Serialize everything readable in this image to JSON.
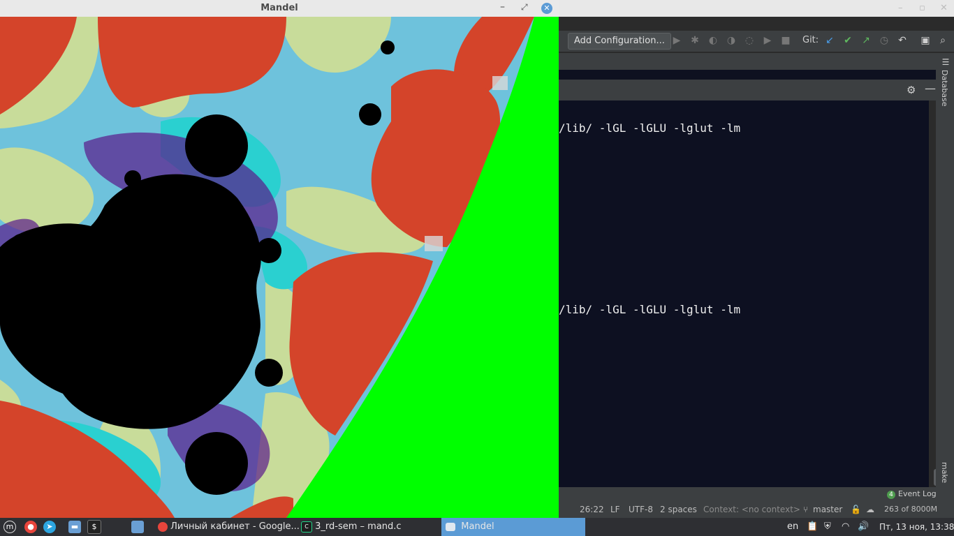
{
  "mandel_window": {
    "title": "Mandel"
  },
  "ide": {
    "toolbar": {
      "add_configuration": "Add Configuration...",
      "git_label": "Git:"
    },
    "right_tabs": {
      "database": "Database",
      "make": "make"
    },
    "terminal": {
      "lines": [
        "/lib/ -lGL -lGLU -lglut -lm",
        "/lib/ -lGL -lGLU -lglut -lm"
      ]
    },
    "event_log": {
      "badge": "4",
      "label": "Event Log"
    },
    "status": {
      "position": "26:22",
      "line_sep": "LF",
      "encoding": "UTF-8",
      "indent": "2 spaces",
      "context": "Context: <no context>",
      "branch": "master",
      "memory": "263 of 8000M"
    }
  },
  "taskbar": {
    "apps": [
      {
        "label": "Личный кабинет - Google..."
      },
      {
        "label": "3_rd-sem – mand.c"
      },
      {
        "label": "Mandel"
      }
    ],
    "tray": {
      "lang": "en",
      "clock": "Пт, 13 ноя, 13:38"
    }
  }
}
